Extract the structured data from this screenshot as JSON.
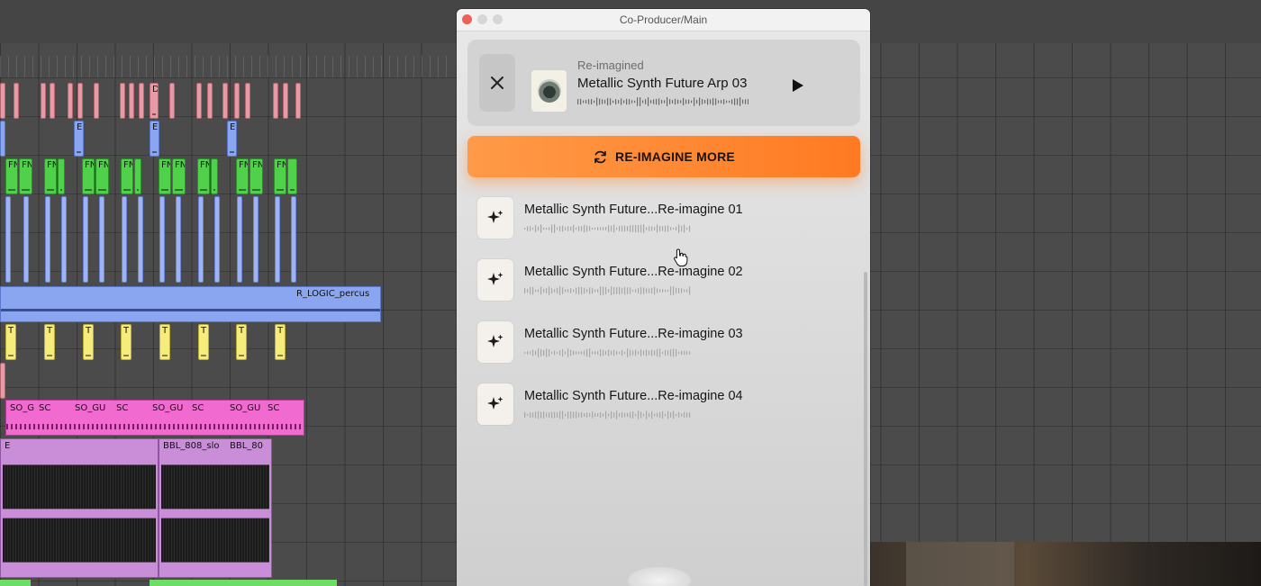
{
  "window": {
    "title": "Co-Producer/Main"
  },
  "now_playing": {
    "label": "Re-imagined",
    "title": "Metallic Synth Future Arp 03"
  },
  "actions": {
    "reimagine_more_label": "RE-IMAGINE MORE"
  },
  "results": [
    {
      "title": "Metallic Synth Future...Re-imagine 01"
    },
    {
      "title": "Metallic Synth Future...Re-imagine 02"
    },
    {
      "title": "Metallic Synth Future...Re-imagine 03"
    },
    {
      "title": "Metallic Synth Future...Re-imagine 04"
    }
  ],
  "daw": {
    "clip_labels": {
      "pink": "D",
      "blue": "E",
      "green": "FN",
      "blue2": "R",
      "logic": "R_LOGIC_percus",
      "yellow": "T",
      "mag_a": "SO_G",
      "mag_b": "SO_GU",
      "mag_c": "SC",
      "mag_d": "S",
      "purple_a": "BBL_808_slo",
      "purple_b": "BBL_80",
      "purple_e": "E"
    }
  },
  "colors": {
    "accent": "#ff8a33",
    "close_light": "#ee5f57"
  }
}
